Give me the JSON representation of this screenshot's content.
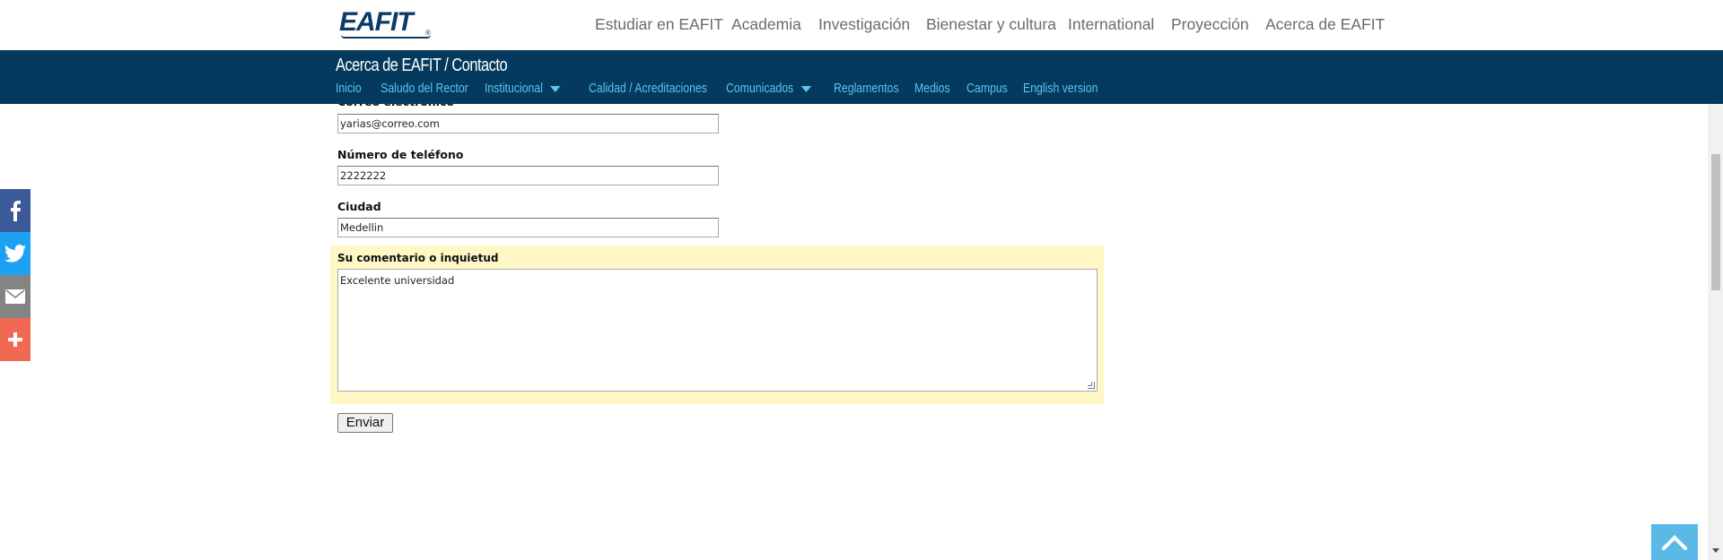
{
  "header": {
    "logo_text": "EAFIT",
    "nav": [
      {
        "label": "Estudiar en EAFIT"
      },
      {
        "label": "Academia"
      },
      {
        "label": "Investigación"
      },
      {
        "label": "Bienestar y cultura"
      },
      {
        "label": "International"
      },
      {
        "label": "Proyección"
      },
      {
        "label": "Acerca de EAFIT"
      }
    ]
  },
  "subheader": {
    "title": "Acerca de EAFIT / Contacto",
    "nav": [
      {
        "label": "Inicio"
      },
      {
        "label": "Saludo del Rector"
      },
      {
        "label": "Institucional"
      },
      {
        "label": "Calidad / Acreditaciones"
      },
      {
        "label": "Comunicados"
      },
      {
        "label": "Reglamentos"
      },
      {
        "label": "Medios"
      },
      {
        "label": "Campus"
      },
      {
        "label": "English version"
      }
    ]
  },
  "form": {
    "email_label": "Correo electrónico",
    "email_value": "yarias@correo.com",
    "phone_label": "Número de teléfono",
    "phone_value": "2222222",
    "city_label": "Ciudad",
    "city_value": "Medellin",
    "comment_label": "Su comentario o inquietud",
    "comment_value": "Excelente universidad",
    "submit_label": "Enviar"
  },
  "share": {
    "icons": [
      "facebook-icon",
      "twitter-icon",
      "email-icon",
      "plus-icon"
    ],
    "colors": [
      "#3b5998",
      "#1da1f2",
      "#848484",
      "#f06a53"
    ]
  },
  "colors": {
    "subheader_bg": "#043a5e",
    "subnav_link": "#5bc4f1",
    "highlight_bg": "#fff7c6",
    "to_top_bg": "#5bb9e8"
  }
}
